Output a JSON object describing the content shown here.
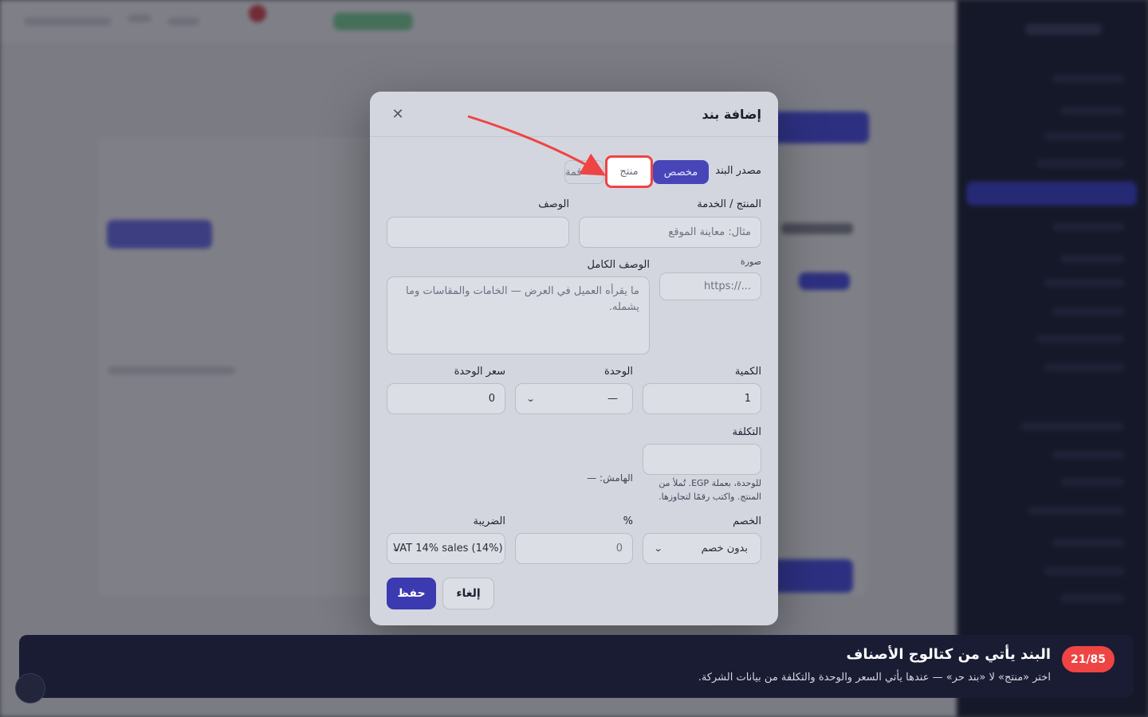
{
  "modal": {
    "title": "إضافة بند",
    "close_icon": "close-icon",
    "source_label": "مصدر البند",
    "source_options": {
      "custom": "مخصص",
      "product": "منتج",
      "partial": "قمة"
    },
    "product_service_label": "المنتج / الخدمة",
    "product_service_placeholder": "مثال: معاينة الموقع",
    "description_label": "الوصف",
    "description_value": "",
    "image_label": "صورة",
    "image_placeholder": "https://...",
    "full_description_label": "الوصف الكامل",
    "full_description_placeholder": "ما يقرأه العميل في العرض — الخامات والمقاسات وما يشمله.",
    "quantity_label": "الكمية",
    "quantity_value": "1",
    "unit_label": "الوحدة",
    "unit_value": "—",
    "unit_price_label": "سعر الوحدة",
    "unit_price_value": "0",
    "cost_label": "التكلفة",
    "cost_value": "",
    "cost_hint_1": "للوحدة، بعملة EGP. تُملأ من",
    "cost_hint_2": "المنتج. واكتب رقمًا لتجاوزها.",
    "margin_text": "الهامش: —",
    "discount_label": "الخصم",
    "discount_value": "بدون خصم",
    "percent_label": "%",
    "percent_placeholder": "0",
    "tax_label": "الضريبة",
    "tax_value": "VAT 14% sales (14%)",
    "save_label": "حفظ",
    "cancel_label": "إلغاء"
  },
  "tour": {
    "step": "21/85",
    "title": "البند يأتي من كتالوج الأصناف",
    "description": "اختر «منتج» لا «بند حر» — عندها يأتي السعر والوحدة والتكلفة من بيانات الشركة."
  },
  "colors": {
    "accent": "#3b3ab0",
    "highlight": "#ef4444",
    "tour_bg": "#1a1c33"
  }
}
